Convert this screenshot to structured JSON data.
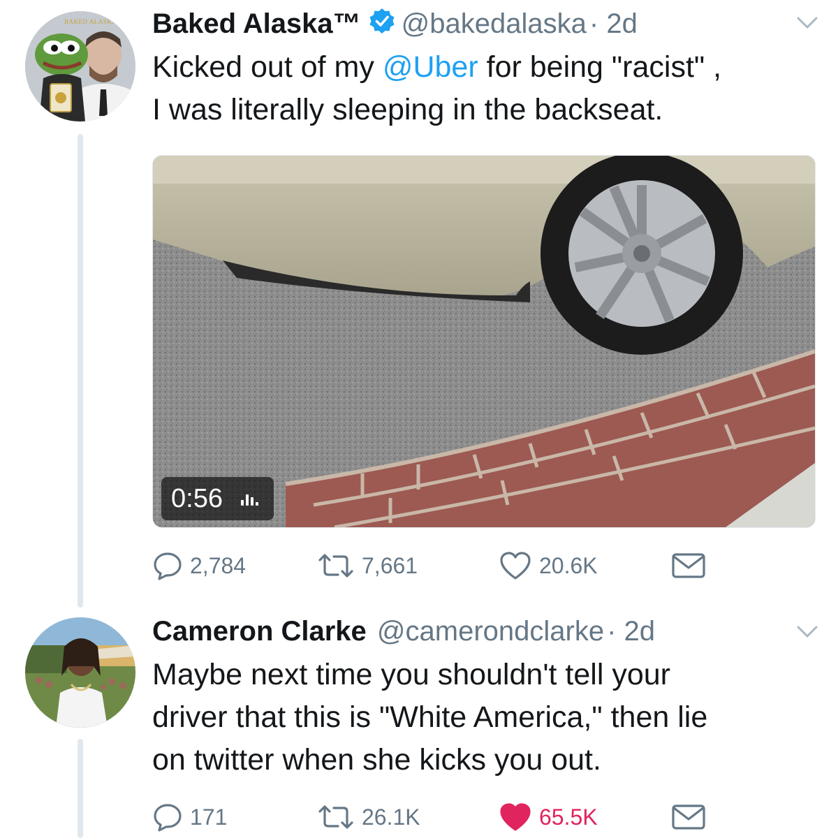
{
  "colors": {
    "link": "#1da1f2",
    "muted": "#657786",
    "like_active": "#e0245e",
    "verified": "#1da1f2"
  },
  "tweets": [
    {
      "name": "Baked Alaska™",
      "handle": "@bakedalaska",
      "time": "· 2d",
      "avatar_text": "BAKED ALASKA",
      "text_before": "Kicked out of my ",
      "mention": "@Uber",
      "text_after": " for being \"racist\" ,",
      "text_line2": "I was literally sleeping in the backseat.",
      "media": {
        "type": "video",
        "duration": "0:56"
      },
      "actions": {
        "replies": "2,784",
        "retweets": "7,661",
        "likes": "20.6K",
        "liked": false
      }
    },
    {
      "name": "Cameron Clarke",
      "handle": "@camerondclarke",
      "time": "· 2d",
      "text_lines": [
        "Maybe next time you shouldn't tell your",
        "driver that this is \"White America,\" then lie",
        "on twitter when she kicks you out."
      ],
      "actions": {
        "replies": "171",
        "retweets": "26.1K",
        "likes": "65.5K",
        "liked": true
      }
    }
  ],
  "icons": [
    "verified-badge-icon",
    "chevron-down-icon",
    "reply-icon",
    "retweet-icon",
    "heart-icon",
    "message-icon",
    "audio-bars-icon"
  ]
}
